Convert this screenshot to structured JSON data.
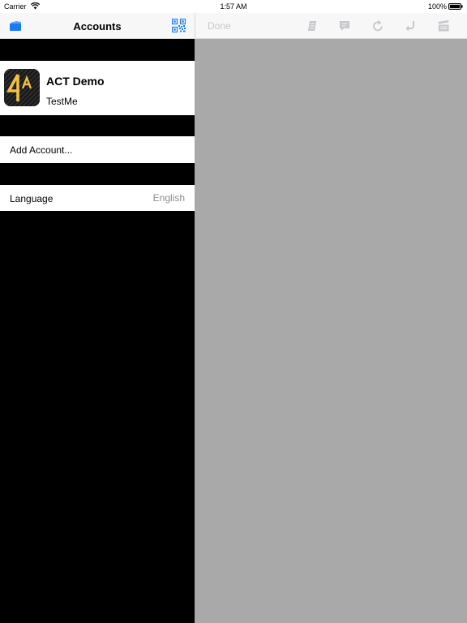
{
  "status_bar": {
    "carrier": "Carrier",
    "time": "1:57 AM",
    "battery": "100%"
  },
  "master": {
    "nav": {
      "title": "Accounts",
      "left_icon": "folder-icon",
      "right_icon": "qr-code-icon"
    },
    "account": {
      "name": "ACT Demo",
      "subtitle": "TestMe",
      "logo_text": "4A"
    },
    "add_account_label": "Add Account...",
    "language": {
      "label": "Language",
      "value": "English"
    }
  },
  "detail": {
    "nav": {
      "done_label": "Done",
      "toolbar_icons": [
        "document-icon",
        "chat-icon",
        "refresh-icon",
        "reply-icon",
        "clapperboard-icon"
      ]
    }
  },
  "colors": {
    "accent": "#1a7cf5",
    "disabled": "#c7c7cc",
    "detail_background": "#a9a9a9"
  }
}
